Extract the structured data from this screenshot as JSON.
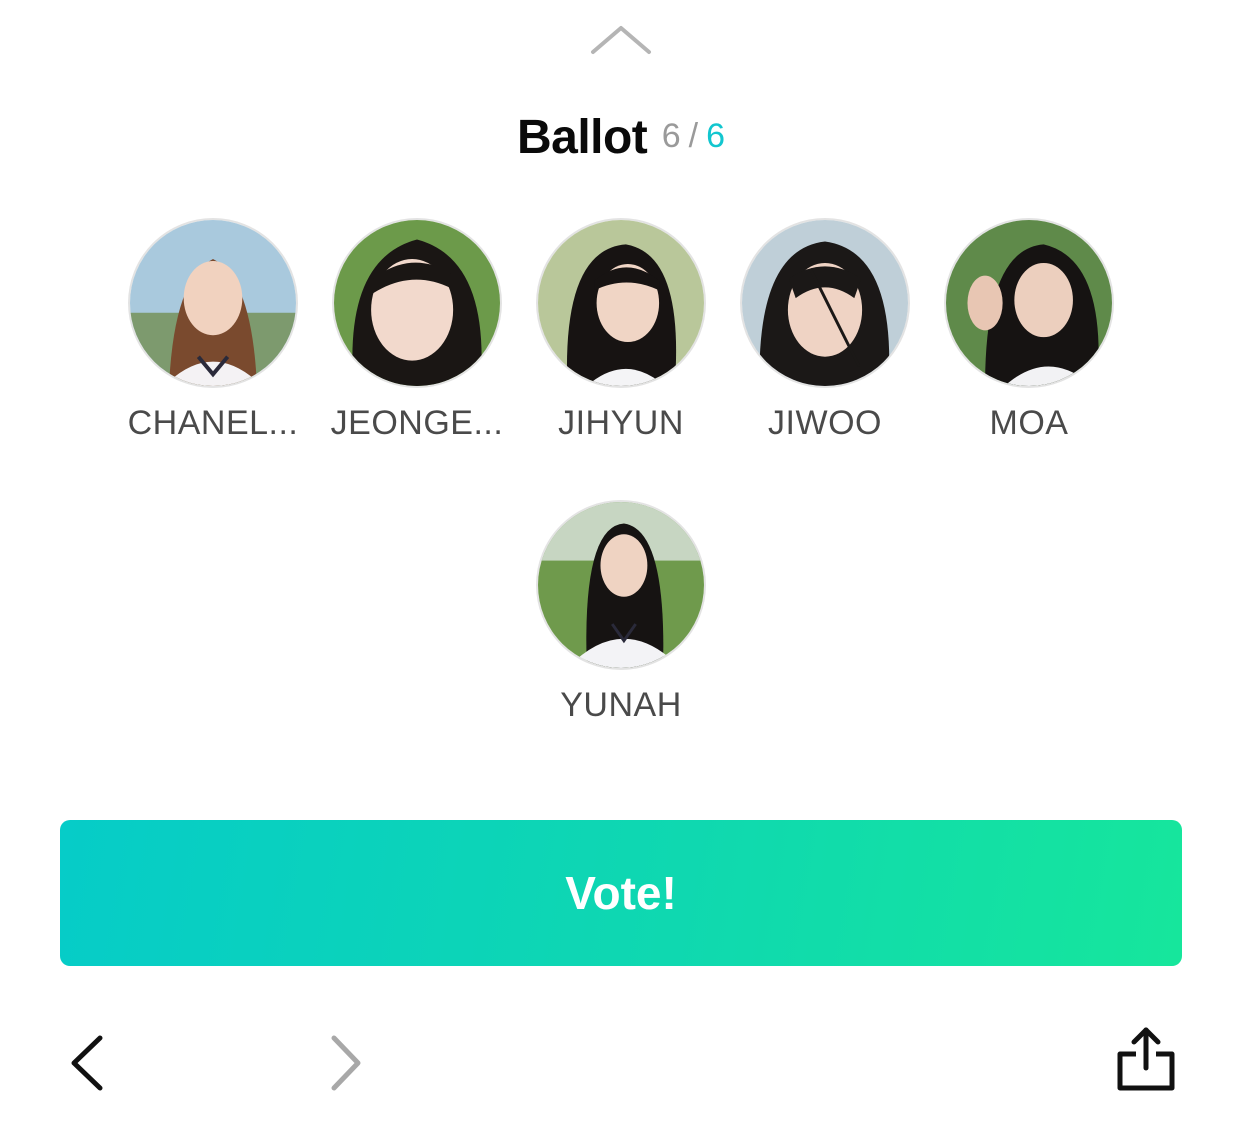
{
  "sheet": {
    "handle_icon": "chevron-up-icon"
  },
  "ballot": {
    "title": "Ballot",
    "selected": "6",
    "separator": "/",
    "total": "6",
    "accent_color": "#12c6cf"
  },
  "members": [
    {
      "name": "CHANEL...",
      "photo": "portrait-photo"
    },
    {
      "name": "JEONGE...",
      "photo": "portrait-photo"
    },
    {
      "name": "JIHYUN",
      "photo": "portrait-photo"
    },
    {
      "name": "JIWOO",
      "photo": "portrait-photo"
    },
    {
      "name": "MOA",
      "photo": "portrait-photo"
    },
    {
      "name": "YUNAH",
      "photo": "portrait-photo"
    }
  ],
  "vote_button": {
    "label": "Vote!",
    "gradient_start": "#06ccc8",
    "gradient_end": "#16e69c"
  },
  "toolbar": {
    "back_icon": "chevron-left-icon",
    "forward_icon": "chevron-right-icon",
    "share_icon": "share-icon"
  }
}
